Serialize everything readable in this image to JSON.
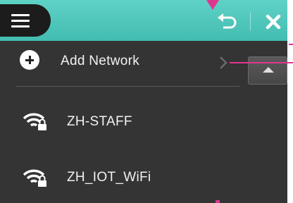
{
  "header": {
    "menu_icon": "hamburger-menu-icon",
    "back_icon": "back-arrow-icon",
    "close_icon": "close-x-icon",
    "accent_color": "#4cc4b8"
  },
  "networks": {
    "add": {
      "label": "Add Network",
      "icon": "plus-circle-icon",
      "chevron_icon": "chevron-right-icon"
    },
    "items": [
      {
        "ssid": "ZH-STAFF",
        "icon": "wifi-secured-icon"
      },
      {
        "ssid": "ZH_IOT_WiFi",
        "icon": "wifi-secured-icon"
      }
    ]
  },
  "scroll": {
    "up_icon": "scroll-up-arrow-icon"
  },
  "annotation_color": "#e0358f"
}
